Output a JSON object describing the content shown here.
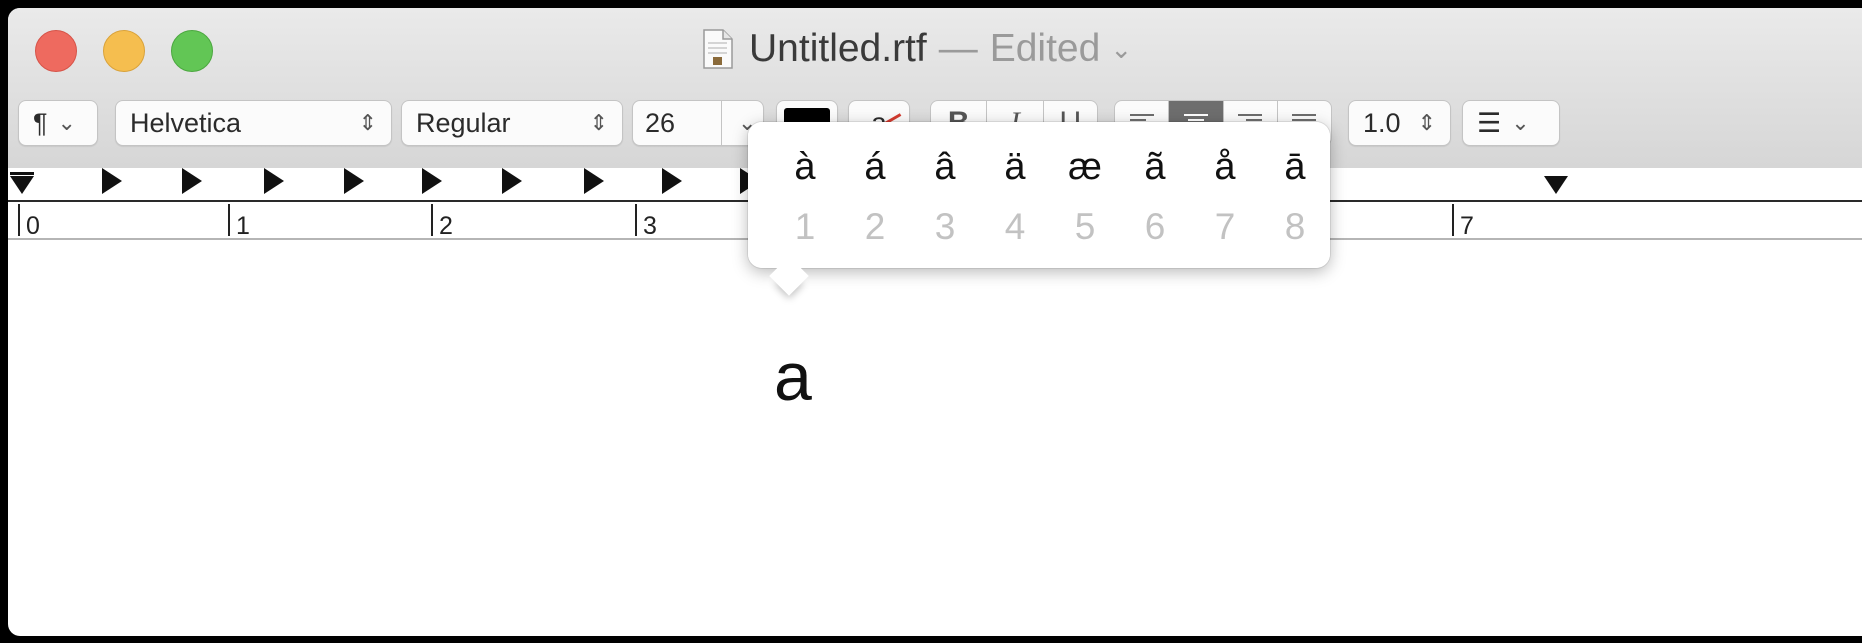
{
  "window": {
    "title": "Untitled.rtf",
    "title_separator": "—",
    "status": "Edited",
    "title_menu_glyph": "⌄"
  },
  "toolbar": {
    "paragraph_glyph": "¶",
    "font_family": "Helvetica",
    "font_style": "Regular",
    "font_size": "26",
    "text_color": "#000000",
    "highlight_letter": "a",
    "bold": "B",
    "italic": "I",
    "underline": "U",
    "alignment_selected": "center",
    "line_spacing": "1.0",
    "list_glyph": "☰"
  },
  "ruler": {
    "numbers": [
      "0",
      "1",
      "2",
      "3",
      "7"
    ]
  },
  "accent_popover": {
    "characters": [
      "à",
      "á",
      "â",
      "ä",
      "æ",
      "ã",
      "å",
      "ā"
    ],
    "shortcuts": [
      "1",
      "2",
      "3",
      "4",
      "5",
      "6",
      "7",
      "8"
    ]
  },
  "document": {
    "typed_text": "a"
  },
  "icons": {
    "chevron": "⌄",
    "updown": "⇕"
  }
}
